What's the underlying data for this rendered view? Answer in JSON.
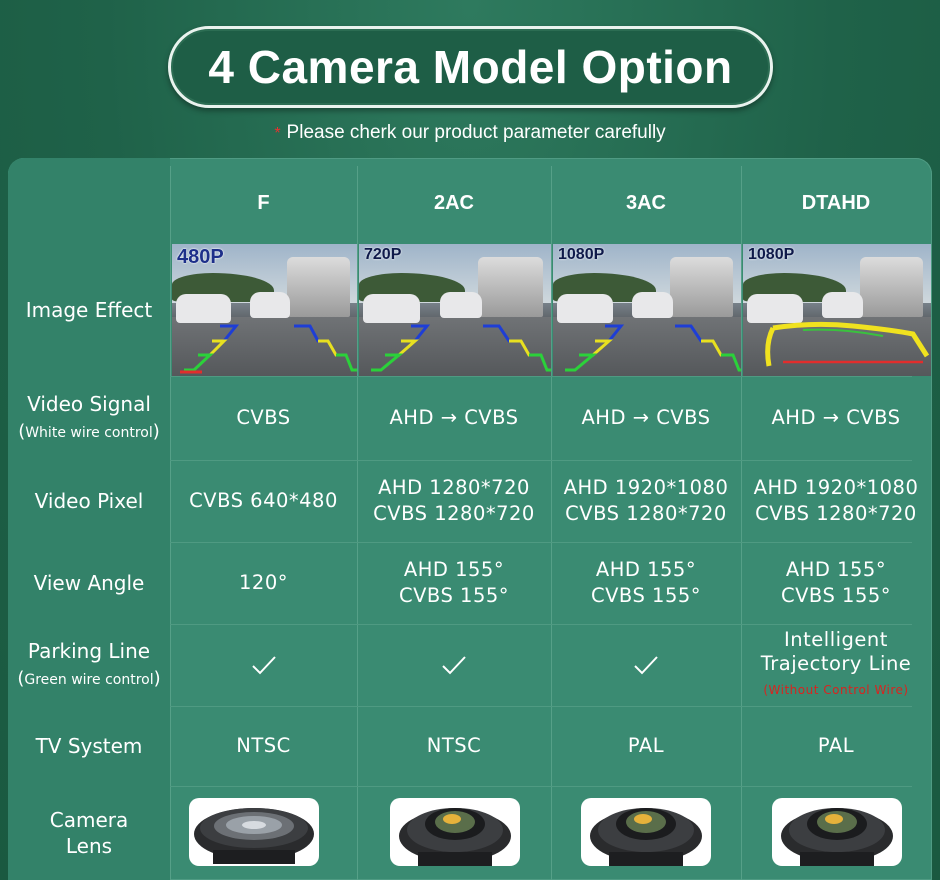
{
  "title": "4 Camera Model Option",
  "subtitle": {
    "star": "*",
    "text": "Please cherk our product parameter carefully"
  },
  "columns": [
    {
      "name": "F",
      "resolution_tag": "480P",
      "video_signal": "CVBS",
      "video_pixel": [
        "CVBS 640*480"
      ],
      "view_angle": [
        "120°"
      ],
      "parking_line": "check",
      "tv_system": "NTSC"
    },
    {
      "name": "2AC",
      "resolution_tag": "720P",
      "video_signal": "AHD → CVBS",
      "video_pixel": [
        "AHD 1280*720",
        "CVBS 1280*720"
      ],
      "view_angle": [
        "AHD 155°",
        "CVBS 155°"
      ],
      "parking_line": "check",
      "tv_system": "NTSC"
    },
    {
      "name": "3AC",
      "resolution_tag": "1080P",
      "video_signal": "AHD → CVBS",
      "video_pixel": [
        "AHD 1920*1080",
        "CVBS 1280*720"
      ],
      "view_angle": [
        "AHD 155°",
        "CVBS 155°"
      ],
      "parking_line": "check",
      "tv_system": "PAL"
    },
    {
      "name": "DTAHD",
      "resolution_tag": "1080P",
      "video_signal": "AHD → CVBS",
      "video_pixel": [
        "AHD 1920*1080",
        "CVBS 1280*720"
      ],
      "view_angle": [
        "AHD 155°",
        "CVBS 155°"
      ],
      "parking_line_text": [
        "Intelligent",
        "Trajectory Line"
      ],
      "parking_line_note": "(Without Control Wire)",
      "tv_system": "PAL"
    }
  ],
  "row_labels": {
    "image_effect": "Image Effect",
    "video_signal": "Video Signal",
    "video_signal_note": "White wire control",
    "video_pixel": "Video Pixel",
    "view_angle": "View Angle",
    "parking_line": "Parking Line",
    "parking_line_note": "Green wire control",
    "tv_system": "TV System",
    "camera_lens": [
      "Camera",
      "Lens"
    ]
  },
  "icons": {
    "check": "check-icon",
    "lens": "camera-lens-icon"
  },
  "colors": {
    "background": "#1f6249",
    "panel": "#3a8b72",
    "label_column": "#338269",
    "note_red": "#d8241f"
  }
}
